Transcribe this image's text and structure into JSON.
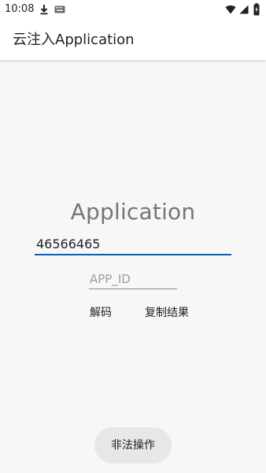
{
  "status_bar": {
    "time": "10:08",
    "icons": [
      "download-icon",
      "keyboard-icon",
      "wifi-icon",
      "signal-icon",
      "battery-icon"
    ]
  },
  "app_bar": {
    "title": "云注入Application"
  },
  "main": {
    "title": "Application",
    "input_value": "46566465",
    "appid_placeholder": "APP_ID",
    "appid_value": "",
    "decode_label": "解码",
    "copy_label": "复制结果"
  },
  "toast": {
    "message": "非法操作"
  },
  "colors": {
    "accent": "#1a5aa0",
    "title_gray": "#757575",
    "toast_bg": "#e7e7e7",
    "app_bg": "#f7f7f7"
  }
}
